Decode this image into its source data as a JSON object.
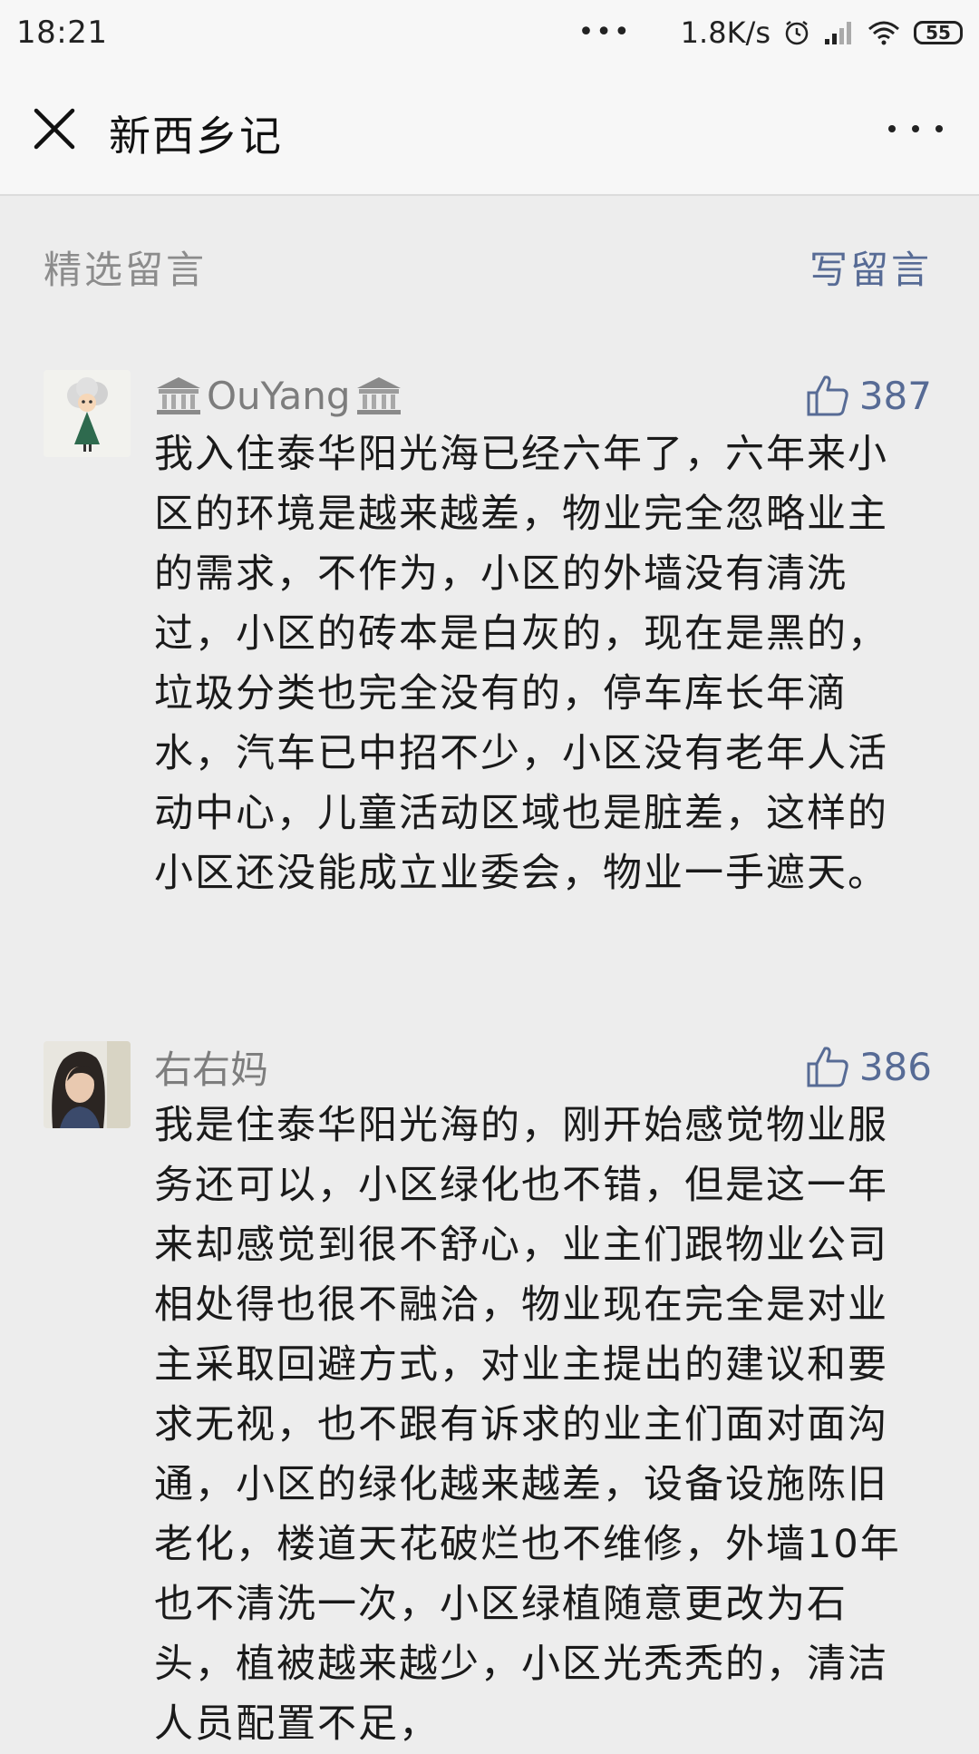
{
  "status_bar": {
    "time": "18:21",
    "dots": "•••",
    "net_speed": "1.8K/s",
    "battery": "55",
    "icons": [
      "alarm-icon",
      "signal-icon",
      "wifi-icon",
      "battery-icon"
    ]
  },
  "nav": {
    "title": "新西乡记",
    "close_icon": "close-icon",
    "more_icon": "more-icon"
  },
  "section": {
    "title": "精选留言",
    "write_label": "写留言"
  },
  "comments": [
    {
      "name": "OuYang",
      "likes": "387",
      "text": "我入住泰华阳光海已经六年了，六年来小区的环境是越来越差，物业完全忽略业主的需求，不作为，小区的外墙没有清洗过，小区的砖本是白灰的，现在是黑的，垃圾分类也完全没有的，停车库长年滴水，汽车已中招不少，小区没有老年人活动中心，儿童活动区域也是脏差，这样的小区还没能成立业委会，物业一手遮天。"
    },
    {
      "name": "右右妈",
      "likes": "386",
      "text": "我是住泰华阳光海的，刚开始感觉物业服务还可以，小区绿化也不错，但是这一年来却感觉到很不舒心，业主们跟物业公司相处得也很不融洽，物业现在完全是对业主采取回避方式，对业主提出的建议和要求无视，也不跟有诉求的业主们面对面沟通，小区的绿化越来越差，设备设施陈旧老化，楼道天花破烂也不维修，外墙10年也不清洗一次，小区绿植随意更改为石头，植被越来越少，小区光秃秃的，清洁人员配置不足，"
    }
  ],
  "colors": {
    "background": "#ededed",
    "link": "#576b95",
    "muted": "#8c8c8c",
    "text": "#1a1a1a"
  }
}
